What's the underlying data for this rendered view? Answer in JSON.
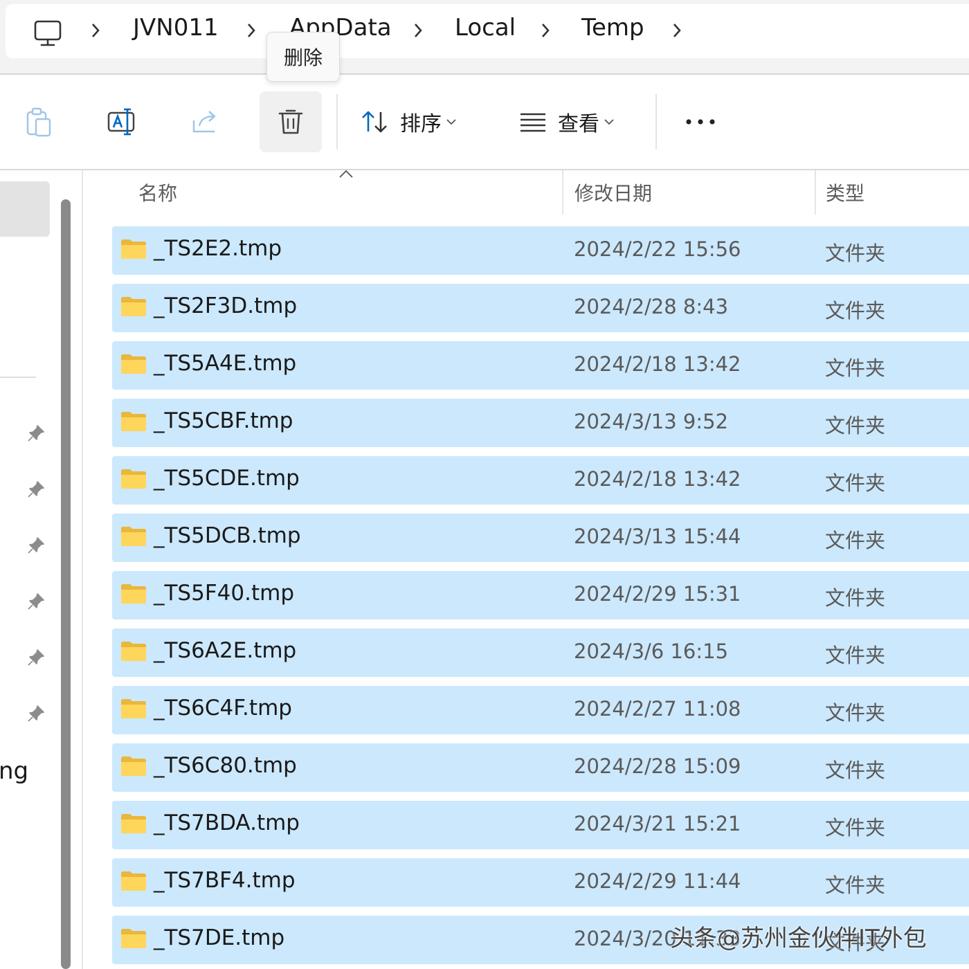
{
  "breadcrumb": {
    "items": [
      "JVN011",
      "AppData",
      "Local",
      "Temp"
    ]
  },
  "tooltip": {
    "text": "删除"
  },
  "toolbar": {
    "sort_label": "排序",
    "view_label": "查看"
  },
  "nav": {
    "fragment_text": "ng"
  },
  "columns": {
    "name": "名称",
    "date": "修改日期",
    "type": "类型"
  },
  "rows": [
    {
      "name": "_TS2E2.tmp",
      "date": "2024/2/22 15:56",
      "type": "文件夹"
    },
    {
      "name": "_TS2F3D.tmp",
      "date": "2024/2/28 8:43",
      "type": "文件夹"
    },
    {
      "name": "_TS5A4E.tmp",
      "date": "2024/2/18 13:42",
      "type": "文件夹"
    },
    {
      "name": "_TS5CBF.tmp",
      "date": "2024/3/13 9:52",
      "type": "文件夹"
    },
    {
      "name": "_TS5CDE.tmp",
      "date": "2024/2/18 13:42",
      "type": "文件夹"
    },
    {
      "name": "_TS5DCB.tmp",
      "date": "2024/3/13 15:44",
      "type": "文件夹"
    },
    {
      "name": "_TS5F40.tmp",
      "date": "2024/2/29 15:31",
      "type": "文件夹"
    },
    {
      "name": "_TS6A2E.tmp",
      "date": "2024/3/6 16:15",
      "type": "文件夹"
    },
    {
      "name": "_TS6C4F.tmp",
      "date": "2024/2/27 11:08",
      "type": "文件夹"
    },
    {
      "name": "_TS6C80.tmp",
      "date": "2024/2/28 15:09",
      "type": "文件夹"
    },
    {
      "name": "_TS7BDA.tmp",
      "date": "2024/3/21 15:21",
      "type": "文件夹"
    },
    {
      "name": "_TS7BF4.tmp",
      "date": "2024/2/29 11:44",
      "type": "文件夹"
    },
    {
      "name": "_TS7DE.tmp",
      "date": "2024/3/20 11:33",
      "type": "文件夹"
    }
  ],
  "watermark": "头条@苏州金伙伴IT外包",
  "colors": {
    "selection": "#cce8fc",
    "folder_yellow": "#ffd65c",
    "accent": "#0067c0"
  }
}
